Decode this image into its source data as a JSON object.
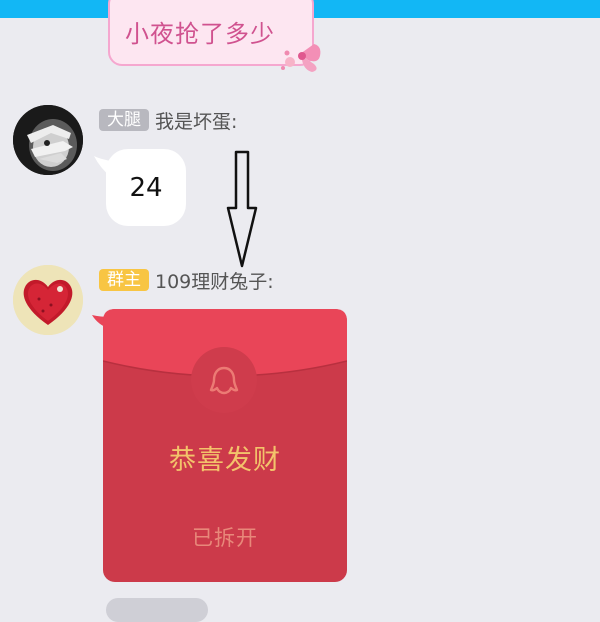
{
  "messages": [
    {
      "text": "小夜抢了多少"
    },
    {
      "role": "大腿",
      "name": "我是坏蛋:",
      "text": "24"
    },
    {
      "role": "群主",
      "name": "109理财兔子:",
      "red_packet": {
        "title": "恭喜发财",
        "status": "已拆开"
      }
    }
  ],
  "colors": {
    "topbar": "#12b7f5",
    "background": "#ebebf0",
    "red_packet": "#cc3a4a",
    "red_packet_flap": "#e94558",
    "red_packet_title": "#f3c36b",
    "badge_gold": "#f8c543",
    "badge_gray": "#b8b8bf"
  }
}
